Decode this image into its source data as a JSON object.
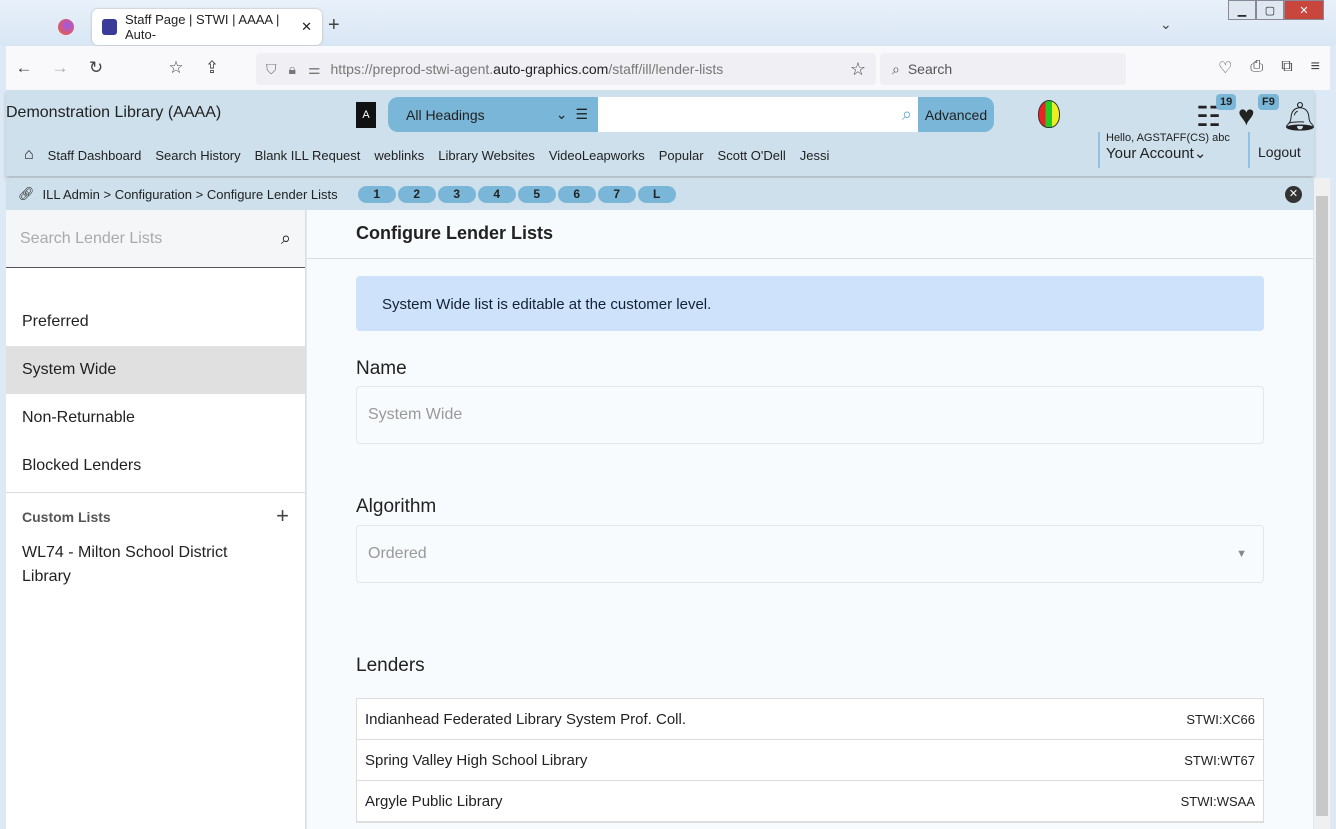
{
  "browser": {
    "tab_title": "Staff Page | STWI | AAAA | Auto-",
    "url_prefix": "https://preprod-stwi-agent.",
    "url_domain": "auto-graphics.com",
    "url_path": "/staff/ill/lender-lists",
    "search_placeholder": "Search"
  },
  "header": {
    "library": "Demonstration Library (AAAA)",
    "search_type": "All Headings",
    "advanced": "Advanced",
    "list_badge": "19",
    "fav_badge": "F9",
    "hello": "Hello, AGSTAFF(CS) abc",
    "account": "Your Account",
    "logout": "Logout",
    "menu": [
      "Staff Dashboard",
      "Search History",
      "Blank ILL Request",
      "weblinks",
      "Library Websites",
      "VideoLeapworks",
      "Popular",
      "Scott O'Dell",
      "Jessi"
    ]
  },
  "breadcrumb": {
    "items": [
      "ILL Admin",
      "Configuration",
      "Configure Lender Lists"
    ],
    "pills": [
      "1",
      "2",
      "3",
      "4",
      "5",
      "6",
      "7",
      "L"
    ]
  },
  "sidebar": {
    "search_placeholder": "Search Lender Lists",
    "items": [
      "Preferred",
      "System Wide",
      "Non-Returnable",
      "Blocked Lenders"
    ],
    "active": "System Wide",
    "custom_label": "Custom Lists",
    "custom_items": [
      "WL74 - Milton School District Library"
    ]
  },
  "main": {
    "title": "Configure Lender Lists",
    "alert": "System Wide list is editable at the customer level.",
    "name_label": "Name",
    "name_value": "System Wide",
    "algorithm_label": "Algorithm",
    "algorithm_value": "Ordered",
    "lenders_label": "Lenders",
    "lenders": [
      {
        "name": "Indianhead Federated Library System Prof. Coll.",
        "code": "STWI:XC66"
      },
      {
        "name": "Spring Valley High School Library",
        "code": "STWI:WT67"
      },
      {
        "name": "Argyle Public Library",
        "code": "STWI:WSAA"
      }
    ]
  }
}
